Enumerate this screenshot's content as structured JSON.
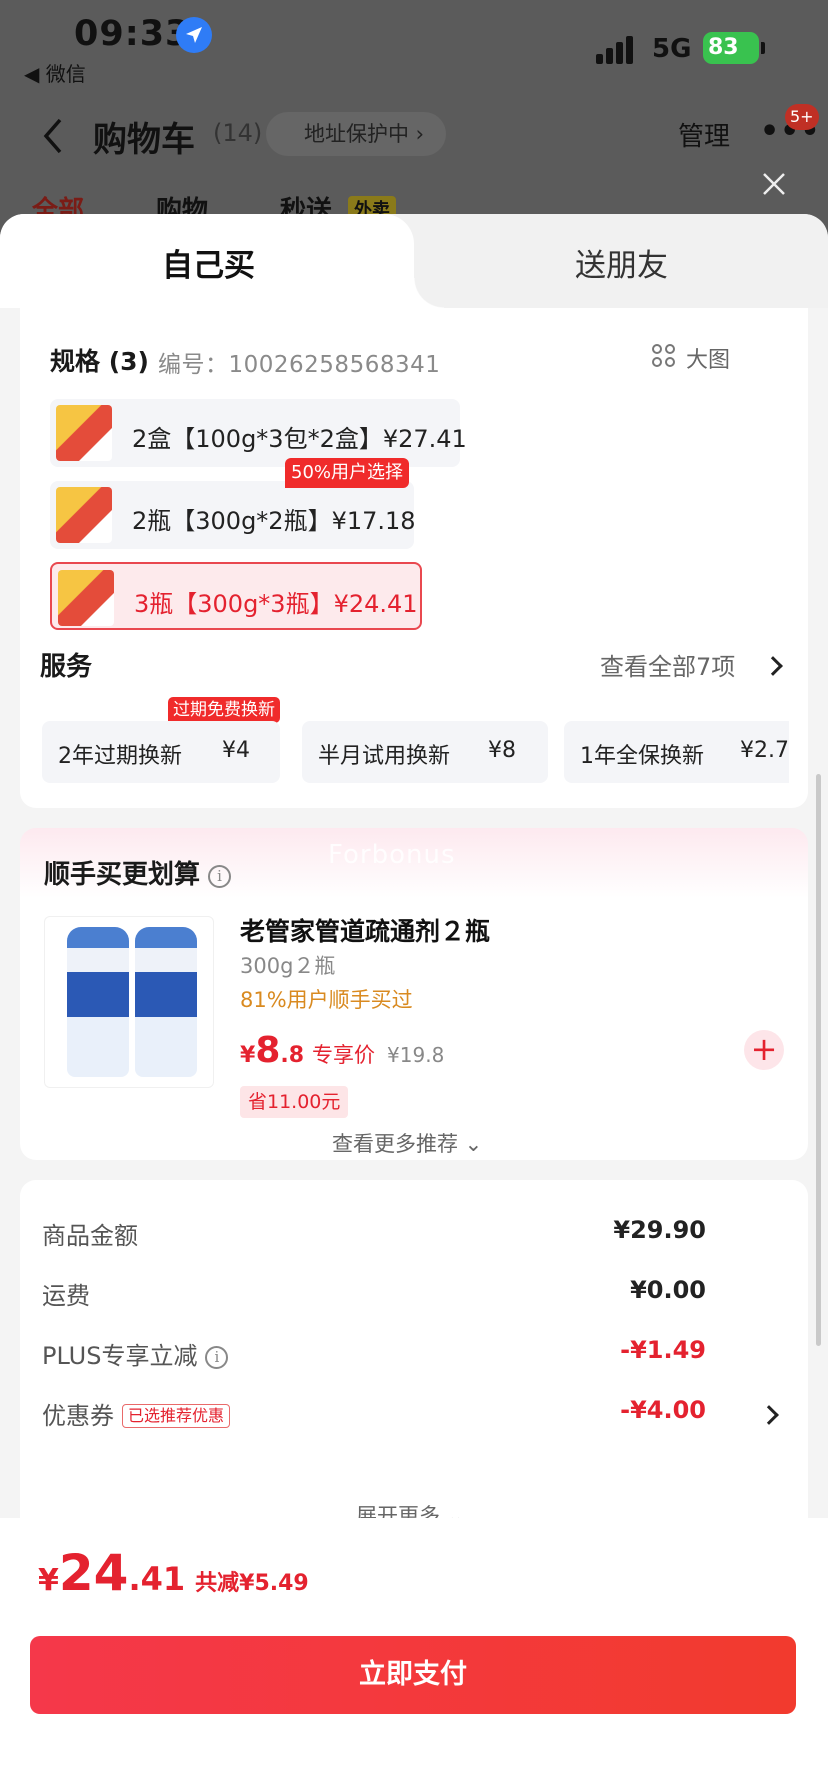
{
  "status_bar": {
    "time": "09:33",
    "back_app": "◀ 微信",
    "network": "5G",
    "battery": "83"
  },
  "navbar": {
    "title": "购物车",
    "count": "(14)",
    "protect": "地址保护中 ›",
    "manage": "管理",
    "more": "•••",
    "badge": "5+"
  },
  "bg_tabs": {
    "all": "全部",
    "shop": "购物",
    "fast": "秒送",
    "waimai": "外卖"
  },
  "sheet_tabs": {
    "self": "自己买",
    "friend": "送朋友"
  },
  "spec": {
    "title": "规格 (3)",
    "number": "编号：10026258568341",
    "big_image": "大图",
    "options": [
      {
        "label": "2盒【100g*3包*2盒】¥27.41",
        "selected": false
      },
      {
        "label": "2瓶【300g*2瓶】¥17.18",
        "selected": false
      },
      {
        "label": "3瓶【300g*3瓶】¥24.41",
        "selected": true
      }
    ],
    "popular_tag": "50%用户选择"
  },
  "service": {
    "title": "服务",
    "more": "查看全部7项",
    "tag": "过期免费换新",
    "items": [
      {
        "name": "2年过期换新",
        "price": "¥4"
      },
      {
        "name": "半月试用换新",
        "price": "¥8"
      },
      {
        "name": "1年全保换新",
        "price": "¥2.7"
      }
    ]
  },
  "recommend": {
    "title": "顺手买更划算",
    "watermark": "Forbonus",
    "product_name": "老管家管道疏通剂２瓶",
    "product_spec": "300g２瓶",
    "bought": "81%用户顺手买过",
    "price_currency": "¥",
    "price_int": "8",
    "price_dec": ".8",
    "price_label": "专享价",
    "price_original": "¥19.8",
    "save": "省11.00元",
    "more": "查看更多推荐 ⌄"
  },
  "summary": {
    "rows": [
      {
        "label": "商品金额",
        "value": "¥29.90"
      },
      {
        "label": "运费",
        "value": "¥0.00"
      },
      {
        "label": "PLUS专享立减",
        "value": "-¥1.49"
      },
      {
        "label": "优惠券",
        "value": "-¥4.00",
        "tag": "已选推荐优惠"
      }
    ],
    "expand": "展开更多 ⌄"
  },
  "bottom": {
    "currency": "¥",
    "total_int": "24",
    "total_dec": ".41",
    "saved": "共减¥5.49",
    "pay_button": "立即支付"
  },
  "colors": {
    "accent": "#e4222f",
    "pay_gradient_start": "#f5384a",
    "pay_gradient_end": "#f23a2e",
    "battery": "#39c24f"
  },
  "icons": [
    "location-arrow-icon",
    "signal-icon",
    "battery-icon",
    "back-chevron-icon",
    "more-icon",
    "close-icon",
    "grid-icon",
    "chevron-right-icon",
    "info-icon",
    "plus-icon"
  ]
}
